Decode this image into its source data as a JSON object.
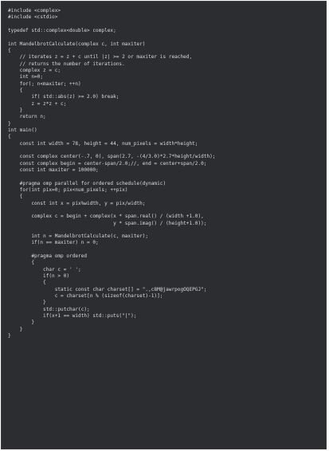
{
  "code_block": {
    "language": "cpp",
    "lines": [
      "#include <complex>",
      "#include <cstdio>",
      "",
      "typedef std::complex<double> complex;",
      "",
      "int MandelbrotCalculate(complex c, int maxiter)",
      "{",
      "    // iterates z = z + c until |z| >= 2 or maxiter is reached,",
      "    // returns the number of iterations.",
      "    complex z = c;",
      "    int n=0;",
      "    for(; n<maxiter; ++n)",
      "    {",
      "        if( std::abs(z) >= 2.0) break;",
      "        z = z*z + c;",
      "    }",
      "    return n;",
      "}",
      "int main()",
      "{",
      "    const int width = 78, height = 44, num_pixels = width*height;",
      "",
      "    const complex center(-.7, 0), span(2.7, -(4/3.0)*2.7*height/width);",
      "    const complex begin = center-span/2.0;//, end = center+span/2.0;",
      "    const int maxiter = 100000;",
      "",
      "    #pragma omp parallel for ordered schedule(dynamic)",
      "    for(int pix=0; pix<num_pixels; ++pix)",
      "    {",
      "        const int x = pix%width, y = pix/width;",
      "",
      "        complex c = begin + complex(x * span.real() / (width +1.0),",
      "                                    y * span.imag() / (height+1.0));",
      "",
      "        int n = MandelbrotCalculate(c, maxiter);",
      "        if(n == maxiter) n = 0;",
      "",
      "        #pragma omp ordered",
      "        {",
      "            char c = ' ';",
      "            if(n > 0)",
      "            {",
      "                static const char charset[] = \".,c8M@jawrpogOQEPGJ\";",
      "                c = charset[n % (sizeof(charset)-1)];",
      "            }",
      "            std::putchar(c);",
      "            if(x+1 == width) std::puts(\"|\");",
      "        }",
      "    }",
      "}"
    ]
  },
  "colors": {
    "background": "#2b2d31",
    "text": "#d7d9dd"
  }
}
